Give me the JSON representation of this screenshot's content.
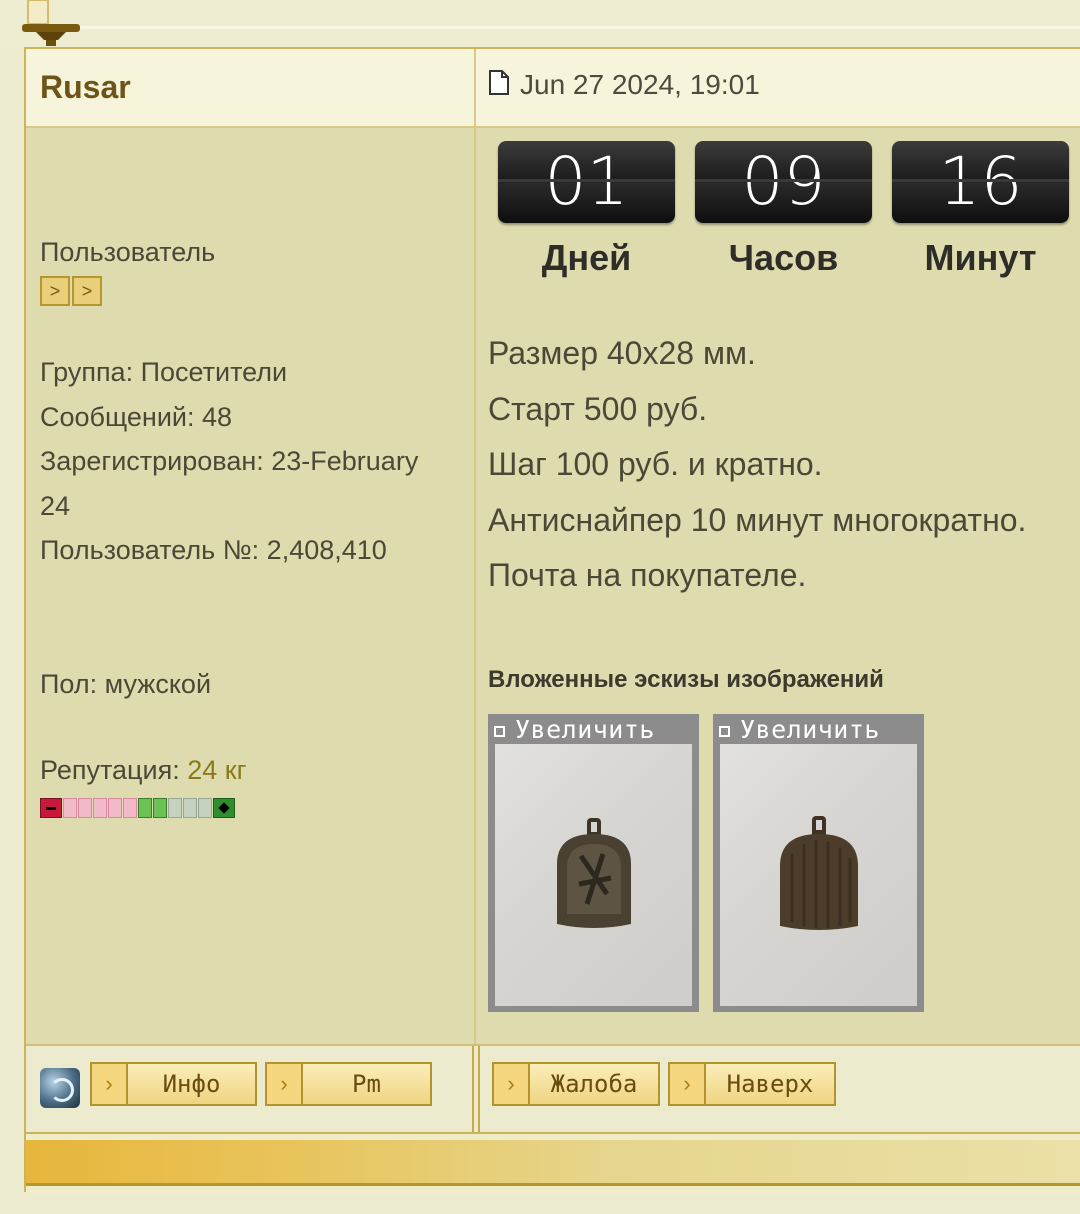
{
  "post": {
    "author": "Rusar",
    "date": "Jun 27 2024, 19:01"
  },
  "user": {
    "rank": "Пользователь",
    "rank_pips": [
      ">",
      ">"
    ],
    "group": "Группа: Посетители",
    "messages": "Сообщений: 48",
    "registered_line1": "Зарегистрирован: 23-February",
    "registered_line2": "24",
    "user_number": "Пользователь №: 2,408,410",
    "gender": "Пол: мужской",
    "reputation_label": "Репутация:",
    "reputation_value": "24 кг"
  },
  "countdown": [
    {
      "value": "01",
      "label": "Дней"
    },
    {
      "value": "09",
      "label": "Часов"
    },
    {
      "value": "16",
      "label": "Минут"
    }
  ],
  "content": {
    "lines": [
      "Размер 40х28 мм.",
      "Старт 500 руб.",
      "Шаг 100 руб. и кратно.",
      "Антиснайпер 10 минут многократно.",
      "Почта на покупателе."
    ],
    "attachments_title": "Вложенные эскизы изображений",
    "thumb_label": "Увеличить"
  },
  "footer": {
    "info_label": "Инфо",
    "pm_label": "Pm",
    "report_label": "Жалоба",
    "top_label": "Наверх"
  },
  "icons": {
    "document": "document-icon",
    "arrow": "arrow-right-icon",
    "avatar": "online-status-icon"
  }
}
